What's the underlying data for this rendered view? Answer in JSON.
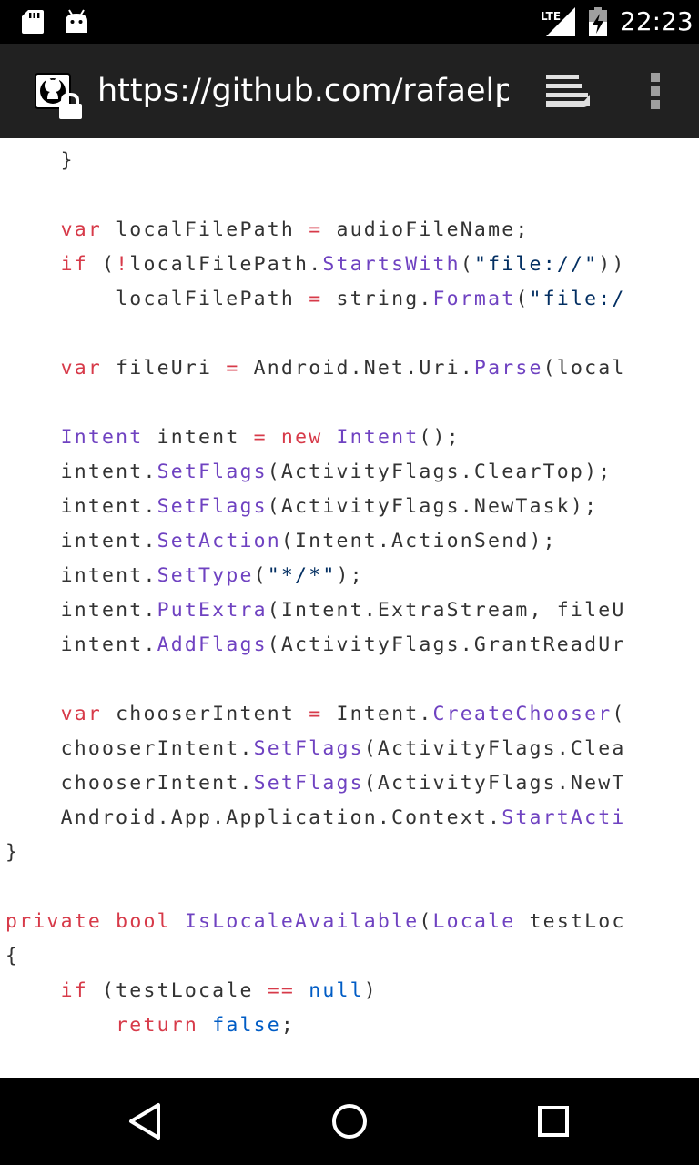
{
  "status_bar": {
    "time": "22:23",
    "network": "LTE",
    "icons": [
      "sd-card-icon",
      "android-debug-icon",
      "lte-signal-icon",
      "battery-charging-icon"
    ]
  },
  "browser": {
    "url": "https://github.com/rafaelpas",
    "site_icon": "github-lock-icon",
    "tabs_icon": "tab-switcher-icon",
    "menu_icon": "overflow-menu-icon"
  },
  "code": {
    "lines": [
      {
        "indent": "    ",
        "tokens": [
          {
            "t": "}"
          }
        ]
      },
      {
        "indent": "",
        "tokens": []
      },
      {
        "indent": "    ",
        "tokens": [
          {
            "t": "var",
            "c": "kw"
          },
          {
            "t": " localFilePath "
          },
          {
            "t": "=",
            "c": "kw"
          },
          {
            "t": " audioFileName;"
          }
        ]
      },
      {
        "indent": "    ",
        "tokens": [
          {
            "t": "if",
            "c": "kw"
          },
          {
            "t": " ("
          },
          {
            "t": "!",
            "c": "kw"
          },
          {
            "t": "localFilePath."
          },
          {
            "t": "StartsWith",
            "c": "fn"
          },
          {
            "t": "("
          },
          {
            "t": "\"file://\"",
            "c": "str"
          },
          {
            "t": "))"
          }
        ]
      },
      {
        "indent": "        ",
        "tokens": [
          {
            "t": "localFilePath "
          },
          {
            "t": "=",
            "c": "kw"
          },
          {
            "t": " string."
          },
          {
            "t": "Format",
            "c": "fn"
          },
          {
            "t": "("
          },
          {
            "t": "\"file:/",
            "c": "str"
          }
        ]
      },
      {
        "indent": "",
        "tokens": []
      },
      {
        "indent": "    ",
        "tokens": [
          {
            "t": "var",
            "c": "kw"
          },
          {
            "t": " fileUri "
          },
          {
            "t": "=",
            "c": "kw"
          },
          {
            "t": " Android.Net.Uri."
          },
          {
            "t": "Parse",
            "c": "fn"
          },
          {
            "t": "(local"
          }
        ]
      },
      {
        "indent": "",
        "tokens": []
      },
      {
        "indent": "    ",
        "tokens": [
          {
            "t": "Intent",
            "c": "fn"
          },
          {
            "t": " intent "
          },
          {
            "t": "=",
            "c": "kw"
          },
          {
            "t": " "
          },
          {
            "t": "new",
            "c": "kw"
          },
          {
            "t": " "
          },
          {
            "t": "Intent",
            "c": "fn"
          },
          {
            "t": "();"
          }
        ]
      },
      {
        "indent": "    ",
        "tokens": [
          {
            "t": "intent."
          },
          {
            "t": "SetFlags",
            "c": "fn"
          },
          {
            "t": "(ActivityFlags.ClearTop);"
          }
        ]
      },
      {
        "indent": "    ",
        "tokens": [
          {
            "t": "intent."
          },
          {
            "t": "SetFlags",
            "c": "fn"
          },
          {
            "t": "(ActivityFlags.NewTask);"
          }
        ]
      },
      {
        "indent": "    ",
        "tokens": [
          {
            "t": "intent."
          },
          {
            "t": "SetAction",
            "c": "fn"
          },
          {
            "t": "(Intent.ActionSend);"
          }
        ]
      },
      {
        "indent": "    ",
        "tokens": [
          {
            "t": "intent."
          },
          {
            "t": "SetType",
            "c": "fn"
          },
          {
            "t": "("
          },
          {
            "t": "\"*/*\"",
            "c": "str"
          },
          {
            "t": ");"
          }
        ]
      },
      {
        "indent": "    ",
        "tokens": [
          {
            "t": "intent."
          },
          {
            "t": "PutExtra",
            "c": "fn"
          },
          {
            "t": "(Intent.ExtraStream, fileU"
          }
        ]
      },
      {
        "indent": "    ",
        "tokens": [
          {
            "t": "intent."
          },
          {
            "t": "AddFlags",
            "c": "fn"
          },
          {
            "t": "(ActivityFlags.GrantReadUr"
          }
        ]
      },
      {
        "indent": "",
        "tokens": []
      },
      {
        "indent": "    ",
        "tokens": [
          {
            "t": "var",
            "c": "kw"
          },
          {
            "t": " chooserIntent "
          },
          {
            "t": "=",
            "c": "kw"
          },
          {
            "t": " Intent."
          },
          {
            "t": "CreateChooser",
            "c": "fn"
          },
          {
            "t": "("
          }
        ]
      },
      {
        "indent": "    ",
        "tokens": [
          {
            "t": "chooserIntent."
          },
          {
            "t": "SetFlags",
            "c": "fn"
          },
          {
            "t": "(ActivityFlags.Clea"
          }
        ]
      },
      {
        "indent": "    ",
        "tokens": [
          {
            "t": "chooserIntent."
          },
          {
            "t": "SetFlags",
            "c": "fn"
          },
          {
            "t": "(ActivityFlags.NewT"
          }
        ]
      },
      {
        "indent": "    ",
        "tokens": [
          {
            "t": "Android.App.Application.Context."
          },
          {
            "t": "StartActi",
            "c": "fn"
          }
        ]
      },
      {
        "indent": "",
        "tokens": [
          {
            "t": "}"
          }
        ]
      },
      {
        "indent": "",
        "tokens": []
      },
      {
        "indent": "",
        "tokens": [
          {
            "t": "private",
            "c": "kw"
          },
          {
            "t": " "
          },
          {
            "t": "bool",
            "c": "kw"
          },
          {
            "t": " "
          },
          {
            "t": "IsLocaleAvailable",
            "c": "fn"
          },
          {
            "t": "("
          },
          {
            "t": "Locale",
            "c": "fn"
          },
          {
            "t": " testLoc"
          }
        ]
      },
      {
        "indent": "",
        "tokens": [
          {
            "t": "{"
          }
        ]
      },
      {
        "indent": "    ",
        "tokens": [
          {
            "t": "if",
            "c": "kw"
          },
          {
            "t": " (testLocale "
          },
          {
            "t": "==",
            "c": "kw"
          },
          {
            "t": " "
          },
          {
            "t": "null",
            "c": "con"
          },
          {
            "t": ")"
          }
        ]
      },
      {
        "indent": "        ",
        "tokens": [
          {
            "t": "return",
            "c": "kw"
          },
          {
            "t": " "
          },
          {
            "t": "false",
            "c": "con"
          },
          {
            "t": ";"
          }
        ]
      }
    ]
  },
  "nav_bar": {
    "back_icon": "back-triangle-icon",
    "home_icon": "home-circle-icon",
    "recents_icon": "recents-square-icon"
  },
  "colors": {
    "keyword": "#d73a49",
    "function": "#6f42c1",
    "string": "#032f62",
    "constant": "#005cc5",
    "text": "#333333",
    "toolbar_bg": "#212121",
    "system_bar_bg": "#000000"
  }
}
